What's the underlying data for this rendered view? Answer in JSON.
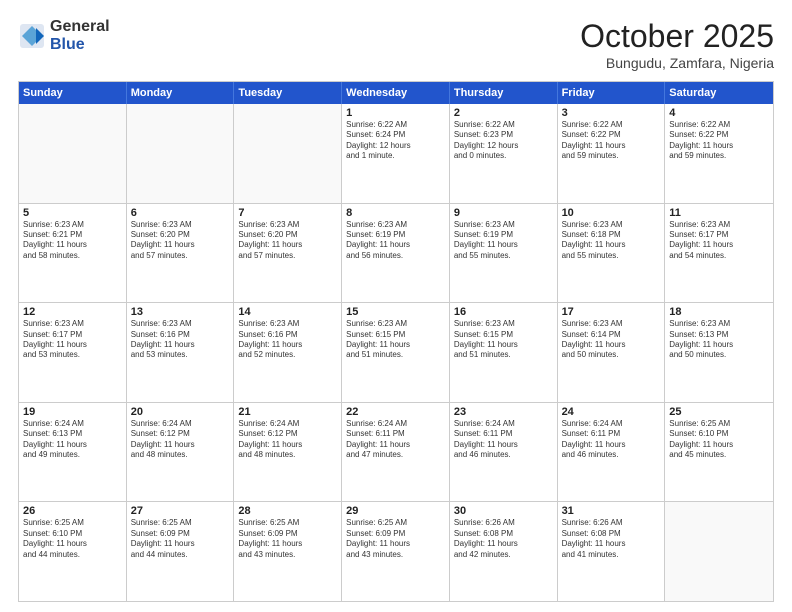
{
  "header": {
    "logo_general": "General",
    "logo_blue": "Blue",
    "month": "October 2025",
    "location": "Bungudu, Zamfara, Nigeria"
  },
  "days_of_week": [
    "Sunday",
    "Monday",
    "Tuesday",
    "Wednesday",
    "Thursday",
    "Friday",
    "Saturday"
  ],
  "weeks": [
    [
      {
        "day": "",
        "text": ""
      },
      {
        "day": "",
        "text": ""
      },
      {
        "day": "",
        "text": ""
      },
      {
        "day": "1",
        "text": "Sunrise: 6:22 AM\nSunset: 6:24 PM\nDaylight: 12 hours\nand 1 minute."
      },
      {
        "day": "2",
        "text": "Sunrise: 6:22 AM\nSunset: 6:23 PM\nDaylight: 12 hours\nand 0 minutes."
      },
      {
        "day": "3",
        "text": "Sunrise: 6:22 AM\nSunset: 6:22 PM\nDaylight: 11 hours\nand 59 minutes."
      },
      {
        "day": "4",
        "text": "Sunrise: 6:22 AM\nSunset: 6:22 PM\nDaylight: 11 hours\nand 59 minutes."
      }
    ],
    [
      {
        "day": "5",
        "text": "Sunrise: 6:23 AM\nSunset: 6:21 PM\nDaylight: 11 hours\nand 58 minutes."
      },
      {
        "day": "6",
        "text": "Sunrise: 6:23 AM\nSunset: 6:20 PM\nDaylight: 11 hours\nand 57 minutes."
      },
      {
        "day": "7",
        "text": "Sunrise: 6:23 AM\nSunset: 6:20 PM\nDaylight: 11 hours\nand 57 minutes."
      },
      {
        "day": "8",
        "text": "Sunrise: 6:23 AM\nSunset: 6:19 PM\nDaylight: 11 hours\nand 56 minutes."
      },
      {
        "day": "9",
        "text": "Sunrise: 6:23 AM\nSunset: 6:19 PM\nDaylight: 11 hours\nand 55 minutes."
      },
      {
        "day": "10",
        "text": "Sunrise: 6:23 AM\nSunset: 6:18 PM\nDaylight: 11 hours\nand 55 minutes."
      },
      {
        "day": "11",
        "text": "Sunrise: 6:23 AM\nSunset: 6:17 PM\nDaylight: 11 hours\nand 54 minutes."
      }
    ],
    [
      {
        "day": "12",
        "text": "Sunrise: 6:23 AM\nSunset: 6:17 PM\nDaylight: 11 hours\nand 53 minutes."
      },
      {
        "day": "13",
        "text": "Sunrise: 6:23 AM\nSunset: 6:16 PM\nDaylight: 11 hours\nand 53 minutes."
      },
      {
        "day": "14",
        "text": "Sunrise: 6:23 AM\nSunset: 6:16 PM\nDaylight: 11 hours\nand 52 minutes."
      },
      {
        "day": "15",
        "text": "Sunrise: 6:23 AM\nSunset: 6:15 PM\nDaylight: 11 hours\nand 51 minutes."
      },
      {
        "day": "16",
        "text": "Sunrise: 6:23 AM\nSunset: 6:15 PM\nDaylight: 11 hours\nand 51 minutes."
      },
      {
        "day": "17",
        "text": "Sunrise: 6:23 AM\nSunset: 6:14 PM\nDaylight: 11 hours\nand 50 minutes."
      },
      {
        "day": "18",
        "text": "Sunrise: 6:23 AM\nSunset: 6:13 PM\nDaylight: 11 hours\nand 50 minutes."
      }
    ],
    [
      {
        "day": "19",
        "text": "Sunrise: 6:24 AM\nSunset: 6:13 PM\nDaylight: 11 hours\nand 49 minutes."
      },
      {
        "day": "20",
        "text": "Sunrise: 6:24 AM\nSunset: 6:12 PM\nDaylight: 11 hours\nand 48 minutes."
      },
      {
        "day": "21",
        "text": "Sunrise: 6:24 AM\nSunset: 6:12 PM\nDaylight: 11 hours\nand 48 minutes."
      },
      {
        "day": "22",
        "text": "Sunrise: 6:24 AM\nSunset: 6:11 PM\nDaylight: 11 hours\nand 47 minutes."
      },
      {
        "day": "23",
        "text": "Sunrise: 6:24 AM\nSunset: 6:11 PM\nDaylight: 11 hours\nand 46 minutes."
      },
      {
        "day": "24",
        "text": "Sunrise: 6:24 AM\nSunset: 6:11 PM\nDaylight: 11 hours\nand 46 minutes."
      },
      {
        "day": "25",
        "text": "Sunrise: 6:25 AM\nSunset: 6:10 PM\nDaylight: 11 hours\nand 45 minutes."
      }
    ],
    [
      {
        "day": "26",
        "text": "Sunrise: 6:25 AM\nSunset: 6:10 PM\nDaylight: 11 hours\nand 44 minutes."
      },
      {
        "day": "27",
        "text": "Sunrise: 6:25 AM\nSunset: 6:09 PM\nDaylight: 11 hours\nand 44 minutes."
      },
      {
        "day": "28",
        "text": "Sunrise: 6:25 AM\nSunset: 6:09 PM\nDaylight: 11 hours\nand 43 minutes."
      },
      {
        "day": "29",
        "text": "Sunrise: 6:25 AM\nSunset: 6:09 PM\nDaylight: 11 hours\nand 43 minutes."
      },
      {
        "day": "30",
        "text": "Sunrise: 6:26 AM\nSunset: 6:08 PM\nDaylight: 11 hours\nand 42 minutes."
      },
      {
        "day": "31",
        "text": "Sunrise: 6:26 AM\nSunset: 6:08 PM\nDaylight: 11 hours\nand 41 minutes."
      },
      {
        "day": "",
        "text": ""
      }
    ]
  ]
}
